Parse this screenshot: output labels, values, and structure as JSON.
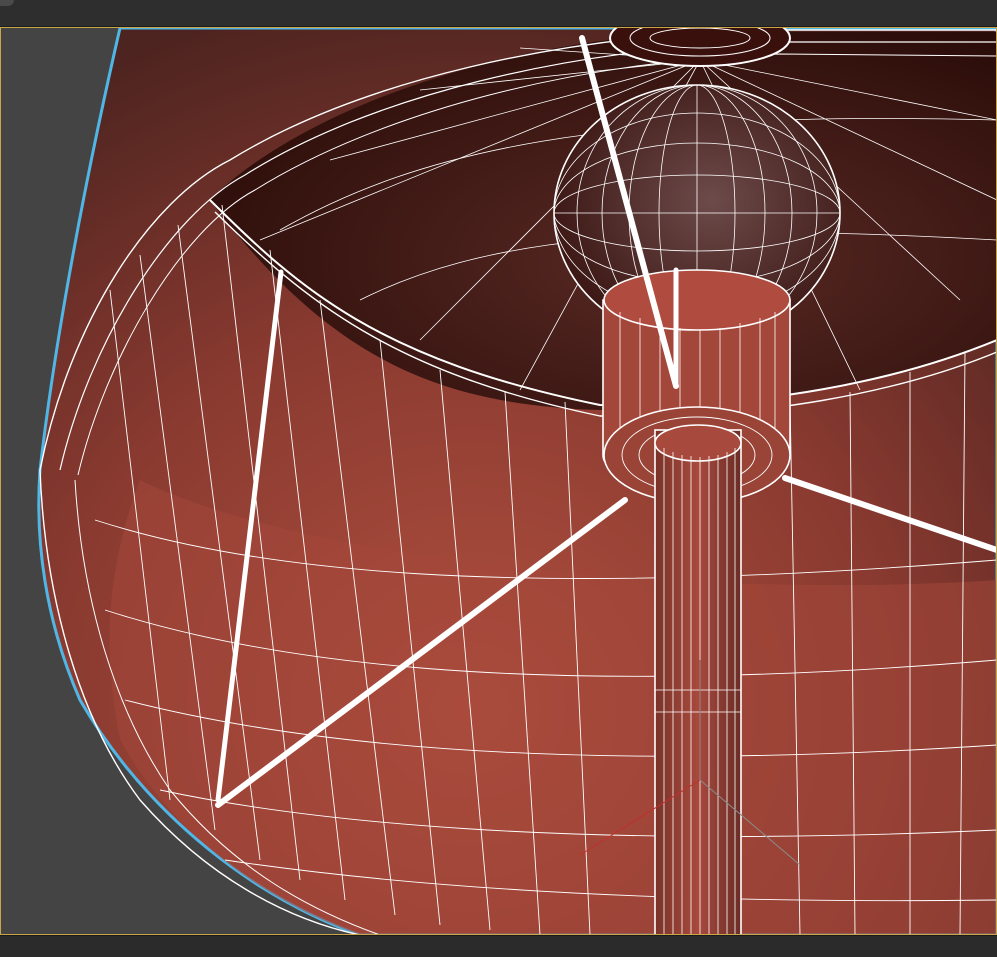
{
  "app": {
    "viewport_label": ""
  },
  "viewport": {
    "render_mode": "shaded-with-wireframe",
    "selection_highlight_color": "#4fb6e6",
    "active_border_color": "#caa64a",
    "wire_color": "#ffffff",
    "shade_color": "#a2473c",
    "background_color": "#444444",
    "object": "lamp-shade-with-bulb-and-stand"
  }
}
